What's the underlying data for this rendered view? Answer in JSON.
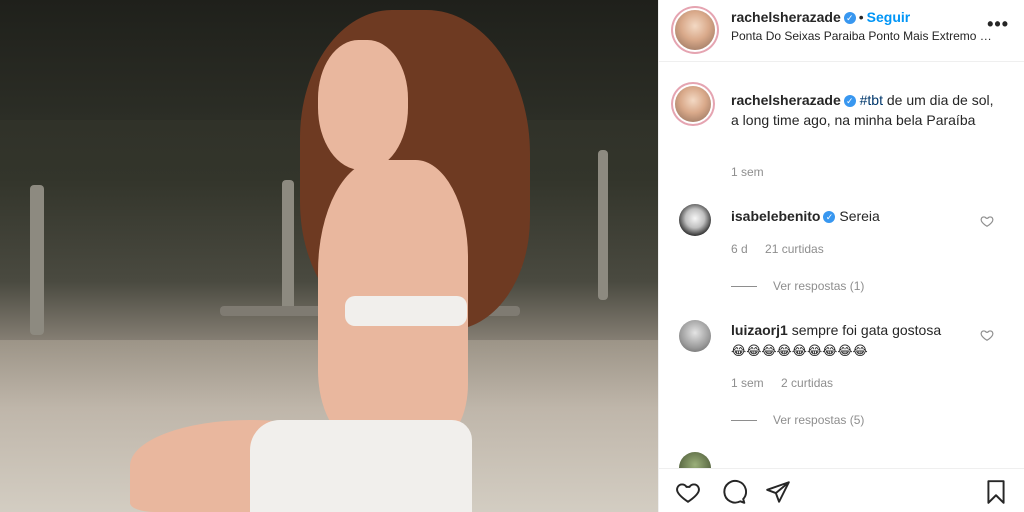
{
  "post": {
    "author": "rachelsherazade",
    "follow_label": "Seguir",
    "location": "Ponta Do Seixas Paraiba Ponto Mais Extremo D...",
    "more_label": "•••",
    "caption_user": "rachelsherazade",
    "caption_hashtag": "#tbt",
    "caption_text": "de um dia de sol, a long time ago, na minha bela Paraíba",
    "caption_time": "1 sem"
  },
  "comments": [
    {
      "user": "isabelebenito",
      "text": "Sereia",
      "time": "6 d",
      "likes": "21 curtidas",
      "replies": "Ver respostas (1)"
    },
    {
      "user": "luizaorj1",
      "text": "sempre foi gata gostosa",
      "emojis": "😂😂😂😂😂😂😂😂😂",
      "time": "1 sem",
      "likes": "2 curtidas",
      "replies": "Ver respostas (5)"
    },
    {
      "user": "",
      "text": ""
    }
  ],
  "icons": {
    "verified": "verified-badge",
    "like": "heart-icon",
    "comment": "comment-icon",
    "share": "paper-plane-icon",
    "save": "bookmark-icon"
  },
  "colors": {
    "link_blue": "#0095f6",
    "verified_blue": "#3897f0",
    "hashtag": "#00376b",
    "muted": "#8e8e8e"
  }
}
